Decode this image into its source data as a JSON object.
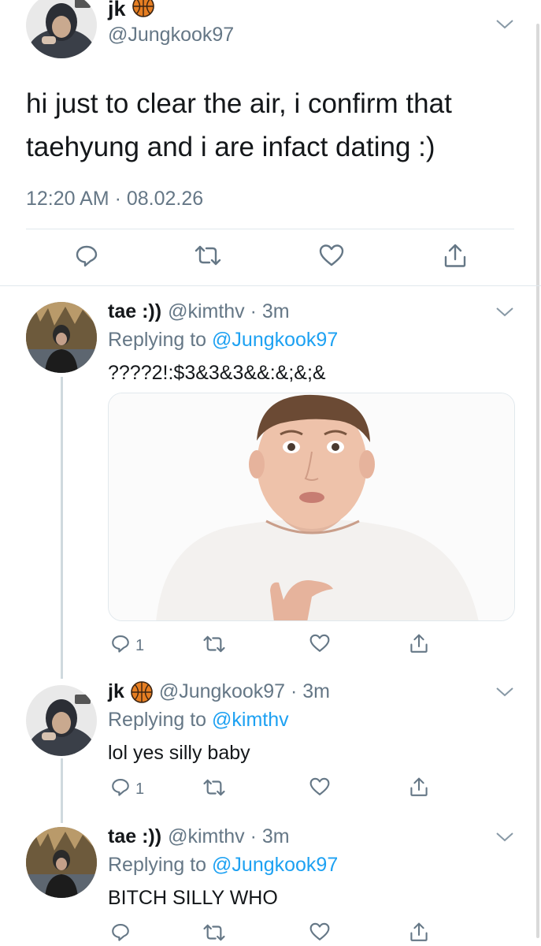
{
  "main_tweet": {
    "display_name": "jk",
    "handle": "@Jungkook97",
    "text_line1": "hi just to clear the air, i confirm that",
    "text_line2": "taehyung and i are infact dating :)",
    "timestamp": "12:20 AM · 08.02.26"
  },
  "replies": [
    {
      "display_name": "tae :))",
      "handle_time": "@kimthv · 3m",
      "replying_prefix": "Replying to",
      "replying_to": "@Jungkook97",
      "text": "????2!:$3&3&3&&:&;&;&",
      "reply_count": "1",
      "has_media": true
    },
    {
      "display_name": "jk",
      "handle_time": "@Jungkook97 · 3m",
      "replying_prefix": "Replying to",
      "replying_to": "@kimthv",
      "text": "lol yes silly baby",
      "reply_count": "1"
    },
    {
      "display_name": "tae :))",
      "handle_time": "@kimthv · 3m",
      "replying_prefix": "Replying to",
      "replying_to": "@Jungkook97",
      "text": "BITCH SILLY WHO",
      "reply_count": ""
    }
  ],
  "icons": [
    "basketball-icon",
    "chevron-down-icon",
    "reply-icon",
    "retweet-icon",
    "like-icon",
    "share-icon"
  ],
  "colors": {
    "link": "#1da1f2",
    "secondary": "#657786",
    "divider": "#e1e8ed"
  }
}
